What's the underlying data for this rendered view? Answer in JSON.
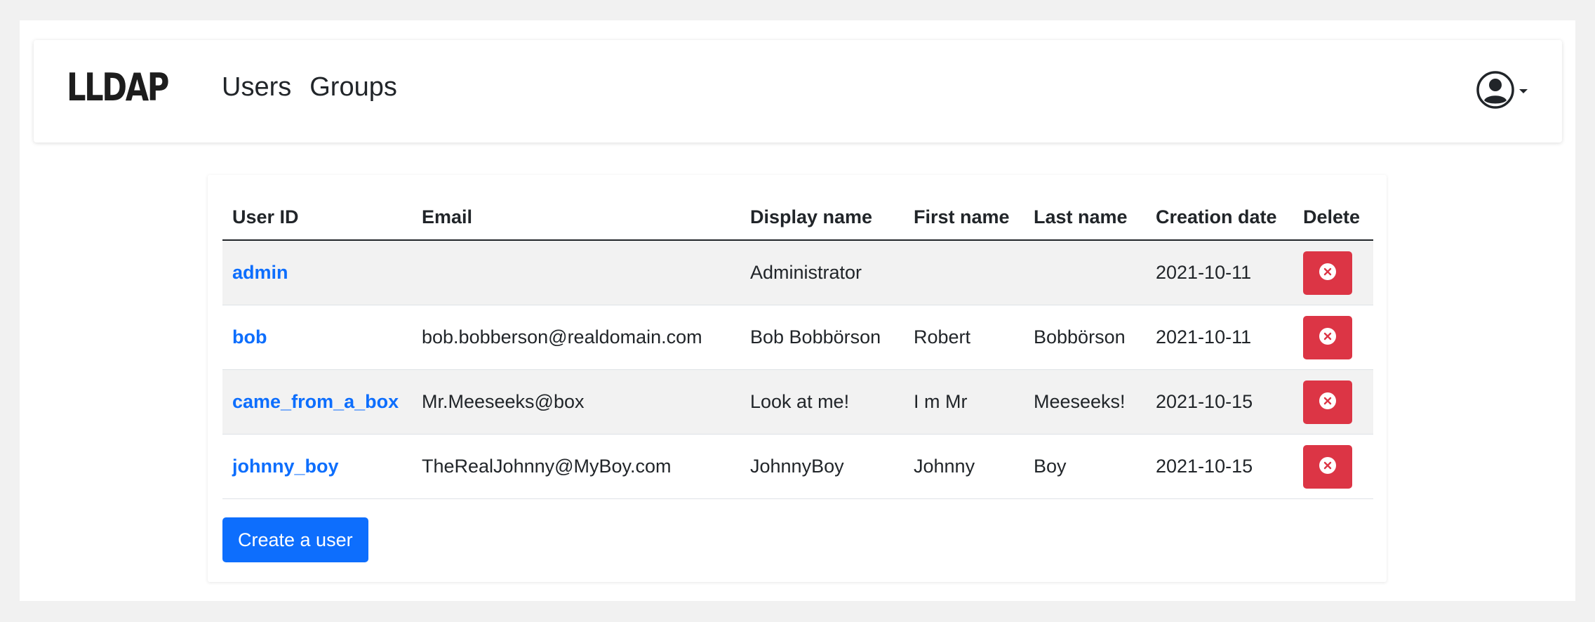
{
  "app": {
    "brand": "LLDAP",
    "nav": [
      {
        "label": "Users"
      },
      {
        "label": "Groups"
      }
    ]
  },
  "users_table": {
    "headers": {
      "user_id": "User ID",
      "email": "Email",
      "display_name": "Display name",
      "first_name": "First name",
      "last_name": "Last name",
      "creation_date": "Creation date",
      "delete": "Delete"
    },
    "rows": [
      {
        "user_id": "admin",
        "email": "",
        "display_name": "Administrator",
        "first_name": "",
        "last_name": "",
        "creation_date": "2021-10-11"
      },
      {
        "user_id": "bob",
        "email": "bob.bobberson@realdomain.com",
        "display_name": "Bob Bobbörson",
        "first_name": "Robert",
        "last_name": "Bobbörson",
        "creation_date": "2021-10-11"
      },
      {
        "user_id": "came_from_a_box",
        "email": "Mr.Meeseeks@box",
        "display_name": "Look at me!",
        "first_name": "I m Mr",
        "last_name": "Meeseeks!",
        "creation_date": "2021-10-15"
      },
      {
        "user_id": "johnny_boy",
        "email": "TheRealJohnny@MyBoy.com",
        "display_name": "JohnnyBoy",
        "first_name": "Johnny",
        "last_name": "Boy",
        "creation_date": "2021-10-15"
      }
    ]
  },
  "actions": {
    "create_user_label": "Create a user"
  },
  "icons": {
    "user_menu": "user-circle-icon",
    "dropdown": "caret-down-icon",
    "delete": "x-circle-icon"
  },
  "colors": {
    "link": "#0d6efd",
    "primary": "#0d6efd",
    "danger": "#dc3545",
    "striped_row": "#f2f2f2"
  }
}
